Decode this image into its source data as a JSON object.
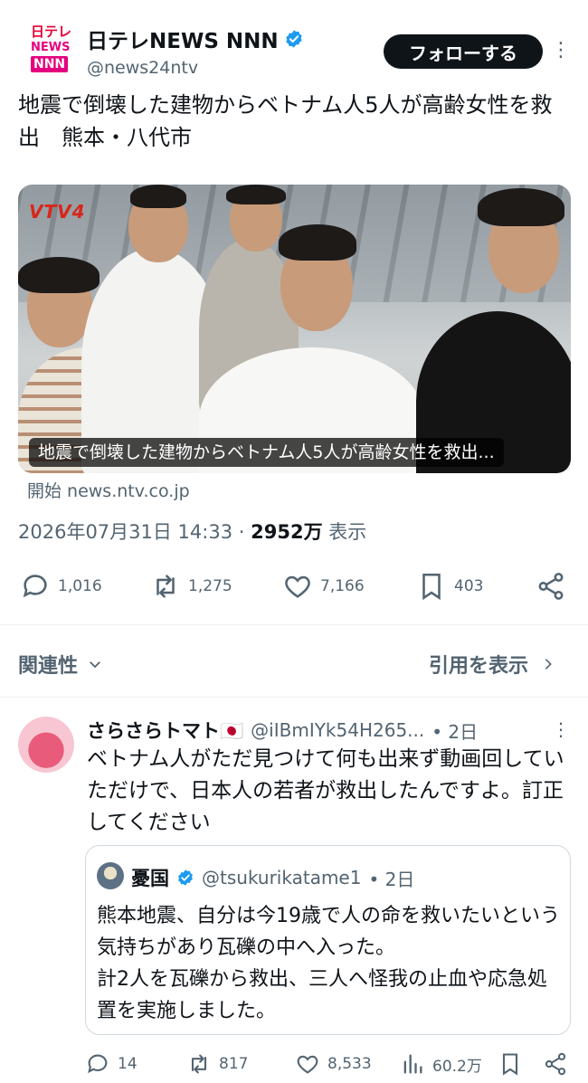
{
  "post": {
    "author_name": "日テレNEWS NNN",
    "handle": "@news24ntv",
    "follow_label": "フォローする",
    "logo_line1": "日テレ",
    "logo_line2": "NEWS",
    "logo_line3": "NNN",
    "text": "地震で倒壊した建物からベトナム人5人が高齢女性を救出　熊本・八代市",
    "media_caption": "地震で倒壊した建物からベトナム人5人が高齢女性を救出...",
    "media_channel_logo": "VTV4",
    "source": "開始 news.ntv.co.jp",
    "timestamp": "2026年07月31日 14:33",
    "views_count": "2952万",
    "views_label": "表示",
    "replies": "1,016",
    "reposts": "1,275",
    "likes": "7,166",
    "bookmarks": "403"
  },
  "controls": {
    "related_label": "関連性",
    "quotes_label": "引用を表示"
  },
  "reply": {
    "author_name": "さらさらトマト🇯🇵",
    "handle": "@iIBmIYk54H265...",
    "time": "• 2日",
    "text": "ベトナム人がただ見つけて何も出来ず動画回していただけで、日本人の若者が救出したんですよ。訂正してください",
    "quote": {
      "author_name": "憂国",
      "handle": "@tsukurikatame1",
      "time": "• 2日",
      "text": "熊本地震、自分は今19歳で人の命を救いたいという気持ちがあり瓦礫の中へ入った。\n計2人を瓦礫から救出、三人へ怪我の止血や応急処置を実施しました。"
    },
    "replies": "14",
    "reposts": "817",
    "likes": "8,533",
    "views": "60.2万"
  },
  "colors": {
    "verified": "#1d9bf0",
    "text": "#0f1419",
    "muted": "#536471",
    "follow_bg": "#0f1419",
    "logo_red": "#e60033",
    "logo_pink": "#e4007f"
  }
}
